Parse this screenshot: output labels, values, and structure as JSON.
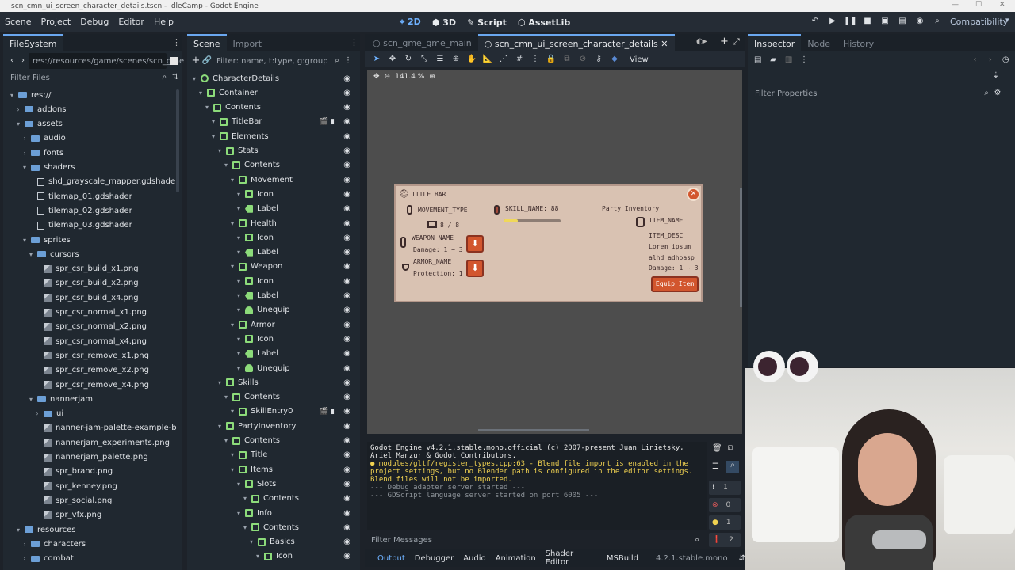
{
  "window_title": "scn_cmn_ui_screen_character_details.tscn - IdleCamp - Godot Engine",
  "menus": [
    "Scene",
    "Project",
    "Debug",
    "Editor",
    "Help"
  ],
  "workspaces": [
    {
      "label": "2D",
      "active": true
    },
    {
      "label": "3D",
      "active": false
    },
    {
      "label": "Script",
      "active": false
    },
    {
      "label": "AssetLib",
      "active": false
    }
  ],
  "renderer": "Compatibility",
  "filesystem": {
    "tab": "FileSystem",
    "path": "res://resources/game/scenes/scn_gme",
    "filter_placeholder": "Filter Files",
    "items": [
      {
        "label": "res://",
        "type": "folder",
        "depth": 0,
        "open": true
      },
      {
        "label": "addons",
        "type": "folder",
        "depth": 1,
        "open": false
      },
      {
        "label": "assets",
        "type": "folder",
        "depth": 1,
        "open": true
      },
      {
        "label": "audio",
        "type": "folder",
        "depth": 2,
        "open": false
      },
      {
        "label": "fonts",
        "type": "folder",
        "depth": 2,
        "open": false
      },
      {
        "label": "shaders",
        "type": "folder",
        "depth": 2,
        "open": true
      },
      {
        "label": "shd_grayscale_mapper.gdshader",
        "type": "file",
        "depth": 3
      },
      {
        "label": "tilemap_01.gdshader",
        "type": "file",
        "depth": 3
      },
      {
        "label": "tilemap_02.gdshader",
        "type": "file",
        "depth": 3
      },
      {
        "label": "tilemap_03.gdshader",
        "type": "file",
        "depth": 3
      },
      {
        "label": "sprites",
        "type": "folder",
        "depth": 2,
        "open": true
      },
      {
        "label": "cursors",
        "type": "folder",
        "depth": 3,
        "open": true
      },
      {
        "label": "spr_csr_build_x1.png",
        "type": "image",
        "depth": 4
      },
      {
        "label": "spr_csr_build_x2.png",
        "type": "image",
        "depth": 4
      },
      {
        "label": "spr_csr_build_x4.png",
        "type": "image",
        "depth": 4
      },
      {
        "label": "spr_csr_normal_x1.png",
        "type": "image",
        "depth": 4
      },
      {
        "label": "spr_csr_normal_x2.png",
        "type": "image",
        "depth": 4
      },
      {
        "label": "spr_csr_normal_x4.png",
        "type": "image",
        "depth": 4
      },
      {
        "label": "spr_csr_remove_x1.png",
        "type": "image",
        "depth": 4
      },
      {
        "label": "spr_csr_remove_x2.png",
        "type": "image",
        "depth": 4
      },
      {
        "label": "spr_csr_remove_x4.png",
        "type": "image",
        "depth": 4
      },
      {
        "label": "nannerjam",
        "type": "folder",
        "depth": 3,
        "open": true
      },
      {
        "label": "ui",
        "type": "folder",
        "depth": 4,
        "open": false
      },
      {
        "label": "nanner-jam-palette-example-by-...",
        "type": "image",
        "depth": 4
      },
      {
        "label": "nannerjam_experiments.png",
        "type": "image",
        "depth": 4
      },
      {
        "label": "nannerjam_palette.png",
        "type": "image",
        "depth": 4
      },
      {
        "label": "spr_brand.png",
        "type": "image",
        "depth": 4
      },
      {
        "label": "spr_kenney.png",
        "type": "image",
        "depth": 4
      },
      {
        "label": "spr_social.png",
        "type": "image",
        "depth": 4
      },
      {
        "label": "spr_vfx.png",
        "type": "image",
        "depth": 4
      },
      {
        "label": "resources",
        "type": "folder",
        "depth": 1,
        "open": true
      },
      {
        "label": "characters",
        "type": "folder",
        "depth": 2,
        "open": false
      },
      {
        "label": "combat",
        "type": "folder",
        "depth": 2,
        "open": false
      }
    ]
  },
  "scene": {
    "tabs": [
      "Scene",
      "Import"
    ],
    "filter_placeholder": "Filter: name, t:type, g:group",
    "nodes": [
      {
        "label": "CharacterDetails",
        "depth": 0,
        "kind": "root"
      },
      {
        "label": "Container",
        "depth": 1,
        "kind": "box"
      },
      {
        "label": "Contents",
        "depth": 2,
        "kind": "box"
      },
      {
        "label": "TitleBar",
        "depth": 3,
        "kind": "box",
        "extra": true
      },
      {
        "label": "Elements",
        "depth": 3,
        "kind": "box"
      },
      {
        "label": "Stats",
        "depth": 4,
        "kind": "box"
      },
      {
        "label": "Contents",
        "depth": 5,
        "kind": "box"
      },
      {
        "label": "Movement",
        "depth": 6,
        "kind": "box"
      },
      {
        "label": "Icon",
        "depth": 7,
        "kind": "box"
      },
      {
        "label": "Label",
        "depth": 7,
        "kind": "label"
      },
      {
        "label": "Health",
        "depth": 6,
        "kind": "box"
      },
      {
        "label": "Icon",
        "depth": 7,
        "kind": "box"
      },
      {
        "label": "Label",
        "depth": 7,
        "kind": "label"
      },
      {
        "label": "Weapon",
        "depth": 6,
        "kind": "box"
      },
      {
        "label": "Icon",
        "depth": 7,
        "kind": "box"
      },
      {
        "label": "Label",
        "depth": 7,
        "kind": "label"
      },
      {
        "label": "Unequip",
        "depth": 7,
        "kind": "button"
      },
      {
        "label": "Armor",
        "depth": 6,
        "kind": "box"
      },
      {
        "label": "Icon",
        "depth": 7,
        "kind": "box"
      },
      {
        "label": "Label",
        "depth": 7,
        "kind": "label"
      },
      {
        "label": "Unequip",
        "depth": 7,
        "kind": "button"
      },
      {
        "label": "Skills",
        "depth": 4,
        "kind": "box"
      },
      {
        "label": "Contents",
        "depth": 5,
        "kind": "box"
      },
      {
        "label": "SkillEntry0",
        "depth": 6,
        "kind": "box",
        "extra": true
      },
      {
        "label": "PartyInventory",
        "depth": 4,
        "kind": "box"
      },
      {
        "label": "Contents",
        "depth": 5,
        "kind": "box"
      },
      {
        "label": "Title",
        "depth": 6,
        "kind": "box"
      },
      {
        "label": "Items",
        "depth": 6,
        "kind": "box"
      },
      {
        "label": "Slots",
        "depth": 7,
        "kind": "box"
      },
      {
        "label": "Contents",
        "depth": 8,
        "kind": "box"
      },
      {
        "label": "Info",
        "depth": 7,
        "kind": "box"
      },
      {
        "label": "Contents",
        "depth": 8,
        "kind": "box"
      },
      {
        "label": "Basics",
        "depth": 9,
        "kind": "box"
      },
      {
        "label": "Icon",
        "depth": 10,
        "kind": "box"
      }
    ]
  },
  "editor_tabs": [
    {
      "label": "scn_gme_gme_main",
      "active": false
    },
    {
      "label": "scn_cmn_ui_screen_character_details",
      "active": true
    }
  ],
  "toolbar": {
    "view_label": "View",
    "zoom": "141.4 %"
  },
  "game_ui": {
    "title": "TITLE BAR",
    "movement": "MOVEMENT_TYPE",
    "health": "8 / 8",
    "skill": "SKILL_NAME: 88",
    "weapon": "WEAPON_NAME",
    "weapon_damage": "Damage: 1 ~ 3",
    "armor": "ARMOR_NAME",
    "armor_protection": "Protection: 1",
    "party_inventory": "Party Inventory",
    "item_name": "ITEM_NAME",
    "item_desc": "ITEM_DESC",
    "item_lorem1": "Lorem ipsum",
    "item_lorem2": "alhd adhoasp",
    "item_damage": "Damage: 1 ~ 3",
    "equip": "Equip Item"
  },
  "output": {
    "lines": [
      {
        "text": "Godot Engine v4.2.1.stable.mono.official (c) 2007-present Juan Linietsky,",
        "kind": "w"
      },
      {
        "text": "Ariel Manzur & Godot Contributors.",
        "kind": "w"
      },
      {
        "text": "● modules/gltf/register_types.cpp:63 - Blend file import is enabled in the",
        "kind": "y"
      },
      {
        "text": "project settings, but no Blender path is configured in the editor settings.",
        "kind": "y"
      },
      {
        "text": "Blend files will not be imported.",
        "kind": "y"
      },
      {
        "text": "--- Debug adapter server started ---",
        "kind": "g"
      },
      {
        "text": "--- GDScript language server started on port 6005 ---",
        "kind": "g"
      }
    ],
    "filter_placeholder": "Filter Messages",
    "counts": {
      "errors": "1",
      "error_icon": "0",
      "warnings": "1",
      "messages": "2"
    }
  },
  "bottom_tabs": [
    "Output",
    "Debugger",
    "Audio",
    "Animation",
    "Shader Editor",
    "MSBuild"
  ],
  "version": "4.2.1.stable.mono",
  "inspector": {
    "tabs": [
      "Inspector",
      "Node",
      "History"
    ],
    "filter_placeholder": "Filter Properties"
  }
}
